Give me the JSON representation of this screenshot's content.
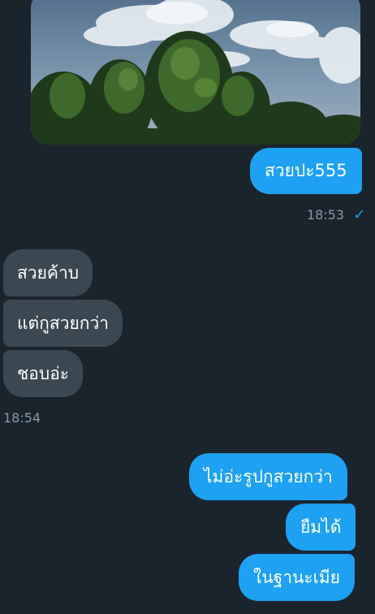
{
  "colors": {
    "background": "#1a242d",
    "outgoing_bubble": "#1da1f2",
    "incoming_bubble": "#3b4751",
    "timestamp": "#8899a6"
  },
  "messages": {
    "m1": {
      "text": "สวยปะ555",
      "direction": "outgoing"
    },
    "t1": {
      "time": "18:53",
      "status_icon": "✓"
    },
    "m2": {
      "text": "สวยค้าบ",
      "direction": "incoming"
    },
    "m3": {
      "text": "แต่กูสวยกว่า",
      "direction": "incoming"
    },
    "m4": {
      "text": "ชอบอ่ะ",
      "direction": "incoming"
    },
    "t2": {
      "time": "18:54"
    },
    "m5": {
      "text": "ไม่อ่ะรูปกูสวยกว่า",
      "direction": "outgoing"
    },
    "m6": {
      "text": "ยืมได้",
      "direction": "outgoing"
    },
    "m7": {
      "text": "ในฐานะเมีย",
      "direction": "outgoing"
    }
  }
}
